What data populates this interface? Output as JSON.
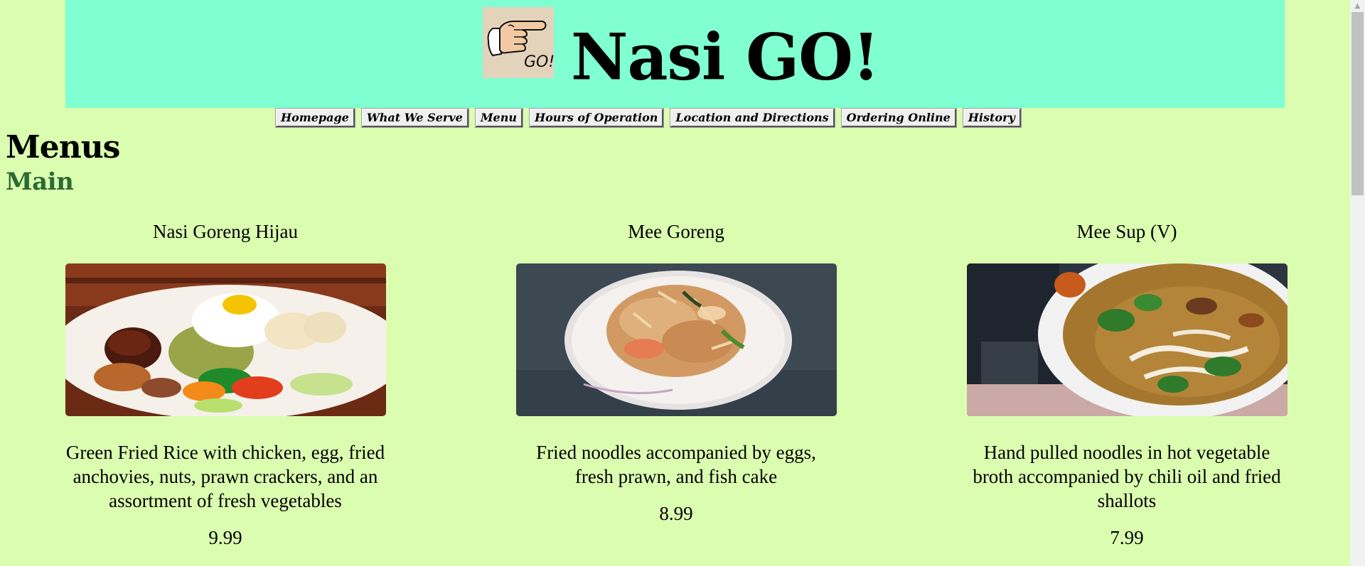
{
  "header": {
    "site_title": "Nasi GO!",
    "logo_text": "GO!",
    "background": "#80ffd2"
  },
  "nav": {
    "items": [
      "Homepage",
      "What We Serve",
      "Menu",
      "Hours of Operation",
      "Location and Directions",
      "Ordering Online",
      "History"
    ]
  },
  "page": {
    "heading": "Menus",
    "subheading": "Main",
    "background": "#dbfdb0",
    "subheading_color": "#2a6a35"
  },
  "menu_items": [
    {
      "name": "Nasi Goreng Hijau",
      "image": "nasi-goreng-hijau-photo",
      "description": "Green Fried Rice with chicken, egg, fried anchovies, nuts, prawn crackers, and an assortment of fresh vegetables",
      "price": "9.99"
    },
    {
      "name": "Mee Goreng",
      "image": "mee-goreng-photo",
      "description": "Fried noodles accompanied by eggs, fresh prawn, and fish cake",
      "price": "8.99"
    },
    {
      "name": "Mee Sup (V)",
      "image": "mee-sup-photo",
      "description": "Hand pulled noodles in hot vegetable broth accompanied by chili oil and fried shallots",
      "price": "7.99"
    }
  ],
  "icons": {
    "logo": "pointing-hand-icon",
    "scroll_up": "chevron-up-icon"
  }
}
